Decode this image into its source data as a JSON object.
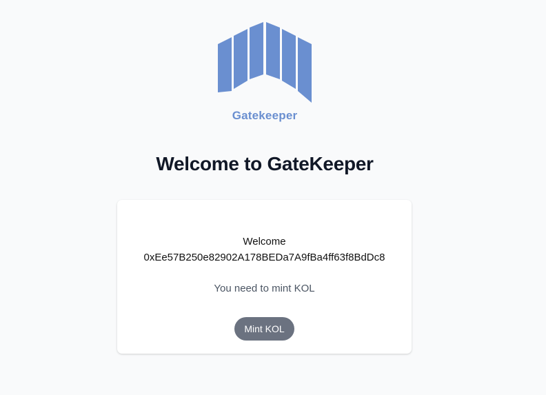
{
  "brand": {
    "name": "Gatekeeper",
    "logo_icon": "gatekeeper-logo-icon",
    "logo_color": "#6a8fd0"
  },
  "header": {
    "title": "Welcome to GateKeeper"
  },
  "card": {
    "welcome_label": "Welcome",
    "wallet_address": "0xEe57B250e82902A178BEDa7A9fBa4ff63f8BdDc8",
    "notice": "You need to mint KOL",
    "mint_button_label": "Mint KOL",
    "mint_button_color": "#6b7280"
  }
}
